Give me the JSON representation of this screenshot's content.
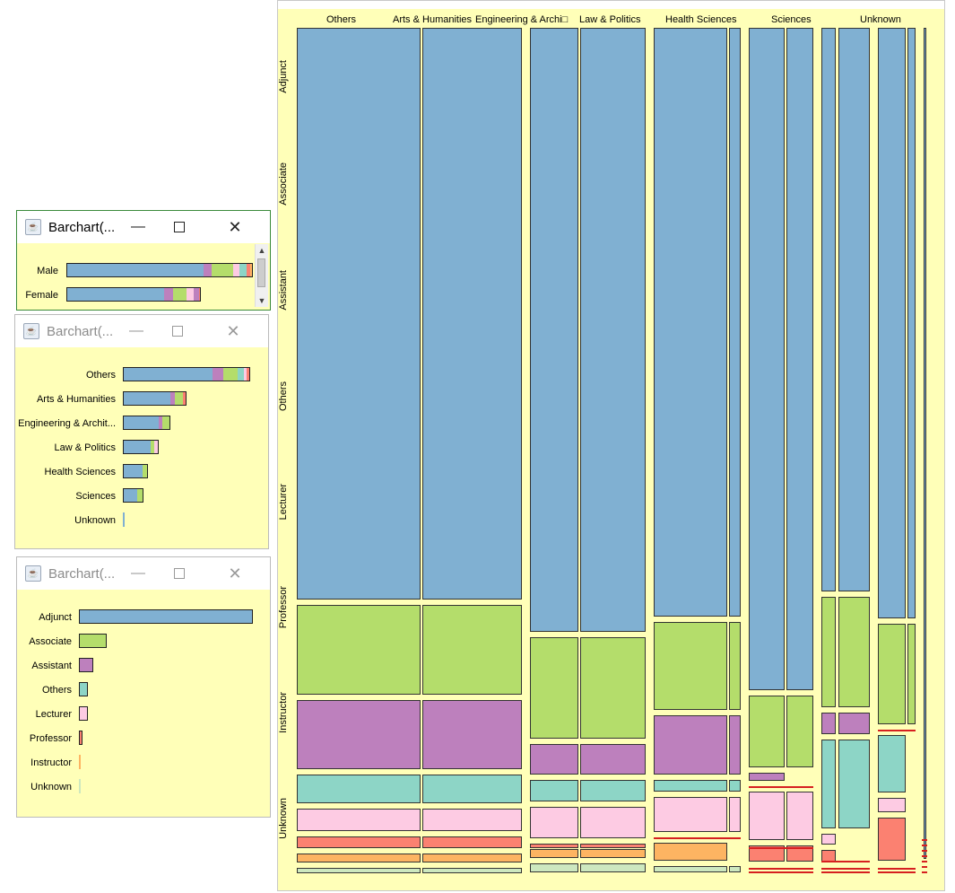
{
  "colors": {
    "Adjunct": "#80b0d2",
    "Associate": "#b4dd6b",
    "Assistant": "#bd80bd",
    "Others": "#8dd5c6",
    "Lecturer": "#fdcbe3",
    "Professor": "#fb8171",
    "Instructor": "#fdb462",
    "Unknown": "#cde8bf",
    "missing": "#d62020",
    "panel_background": "#ffffb8"
  },
  "window1": {
    "title": "Barchart(...",
    "state": "active",
    "rows": [
      {
        "label": "Male",
        "segments": [
          {
            "rank": "Adjunct",
            "value": 0.74
          },
          {
            "rank": "Assistant",
            "value": 0.04
          },
          {
            "rank": "Associate",
            "value": 0.12
          },
          {
            "rank": "Lecturer",
            "value": 0.03
          },
          {
            "rank": "Others",
            "value": 0.04
          },
          {
            "rank": "Professor",
            "value": 0.02
          },
          {
            "rank": "Instructor",
            "value": 0.01
          }
        ]
      },
      {
        "label": "Female",
        "segments": [
          {
            "rank": "Adjunct",
            "value": 0.73
          },
          {
            "rank": "Assistant",
            "value": 0.07
          },
          {
            "rank": "Associate",
            "value": 0.1
          },
          {
            "rank": "Lecturer",
            "value": 0.05
          },
          {
            "rank": "Assistant",
            "value": 0.04
          },
          {
            "rank": "Professor",
            "value": 0.01
          }
        ]
      }
    ],
    "bar_fraction": [
      1.0,
      0.72
    ]
  },
  "window2": {
    "title": "Barchart(...",
    "state": "inactive",
    "rows": [
      {
        "label": "Others",
        "fraction": 1.0,
        "segments": [
          {
            "rank": "Adjunct",
            "value": 0.71
          },
          {
            "rank": "Assistant",
            "value": 0.08
          },
          {
            "rank": "Associate",
            "value": 0.12
          },
          {
            "rank": "Others",
            "value": 0.05
          },
          {
            "rank": "Lecturer",
            "value": 0.02
          },
          {
            "rank": "Professor",
            "value": 0.02
          }
        ]
      },
      {
        "label": "Arts & Humanities",
        "fraction": 0.5,
        "segments": [
          {
            "rank": "Adjunct",
            "value": 0.76
          },
          {
            "rank": "Assistant",
            "value": 0.06
          },
          {
            "rank": "Associate",
            "value": 0.14
          },
          {
            "rank": "Professor",
            "value": 0.04
          }
        ]
      },
      {
        "label": "Engineering & Archit...",
        "fraction": 0.37,
        "segments": [
          {
            "rank": "Adjunct",
            "value": 0.76
          },
          {
            "rank": "Assistant",
            "value": 0.08
          },
          {
            "rank": "Associate",
            "value": 0.16
          }
        ]
      },
      {
        "label": "Law & Politics",
        "fraction": 0.28,
        "segments": [
          {
            "rank": "Adjunct",
            "value": 0.8
          },
          {
            "rank": "Associate",
            "value": 0.1
          },
          {
            "rank": "Lecturer",
            "value": 0.1
          }
        ]
      },
      {
        "label": "Health Sciences",
        "fraction": 0.2,
        "segments": [
          {
            "rank": "Adjunct",
            "value": 0.8
          },
          {
            "rank": "Associate",
            "value": 0.2
          }
        ]
      },
      {
        "label": "Sciences",
        "fraction": 0.16,
        "segments": [
          {
            "rank": "Adjunct",
            "value": 0.73
          },
          {
            "rank": "Associate",
            "value": 0.27
          }
        ]
      },
      {
        "label": "Unknown",
        "fraction": 0.0,
        "segments": [
          {
            "rank": "Adjunct",
            "value": 1.0
          }
        ]
      }
    ]
  },
  "window3": {
    "title": "Barchart(...",
    "state": "inactive",
    "rows": [
      {
        "label": "Adjunct",
        "fraction": 1.0
      },
      {
        "label": "Associate",
        "fraction": 0.16
      },
      {
        "label": "Assistant",
        "fraction": 0.08
      },
      {
        "label": "Others",
        "fraction": 0.05
      },
      {
        "label": "Lecturer",
        "fraction": 0.05
      },
      {
        "label": "Professor",
        "fraction": 0.02
      },
      {
        "label": "Instructor",
        "fraction": 0.005
      },
      {
        "label": "Unknown",
        "fraction": 0.0
      }
    ]
  },
  "mosaic": {
    "column_labels": [
      "Others",
      "Arts & Humanities",
      "Engineering & Archi□",
      "Law & Politics",
      "Health Sciences",
      "Sciences",
      "Unknown"
    ],
    "row_labels": [
      "Adjunct",
      "Associate",
      "Assistant",
      "Others",
      "Lecturer",
      "Professor",
      "Instructor",
      "Unknown"
    ]
  }
}
